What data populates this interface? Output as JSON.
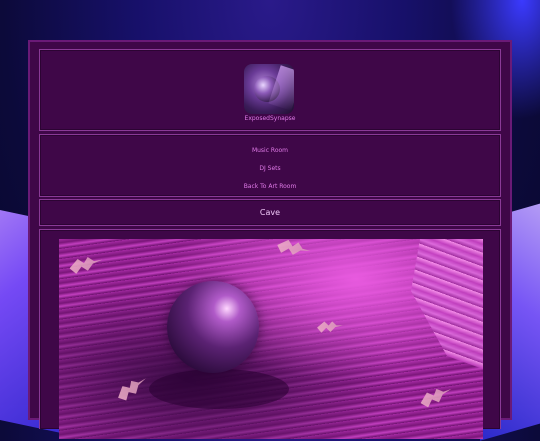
{
  "profile": {
    "username": "ExposedSynapse",
    "avatar_alt": "profile picture"
  },
  "nav": {
    "links": [
      {
        "label": "Music Room"
      },
      {
        "label": "DJ Sets"
      },
      {
        "label": "Back To Art Room"
      }
    ]
  },
  "page": {
    "title": "Cave"
  },
  "colors": {
    "panel_bg": "#3f0748",
    "panel_border": "#8a3a97",
    "link_text": "#e07ae8",
    "title_text": "#f0c8f8"
  }
}
